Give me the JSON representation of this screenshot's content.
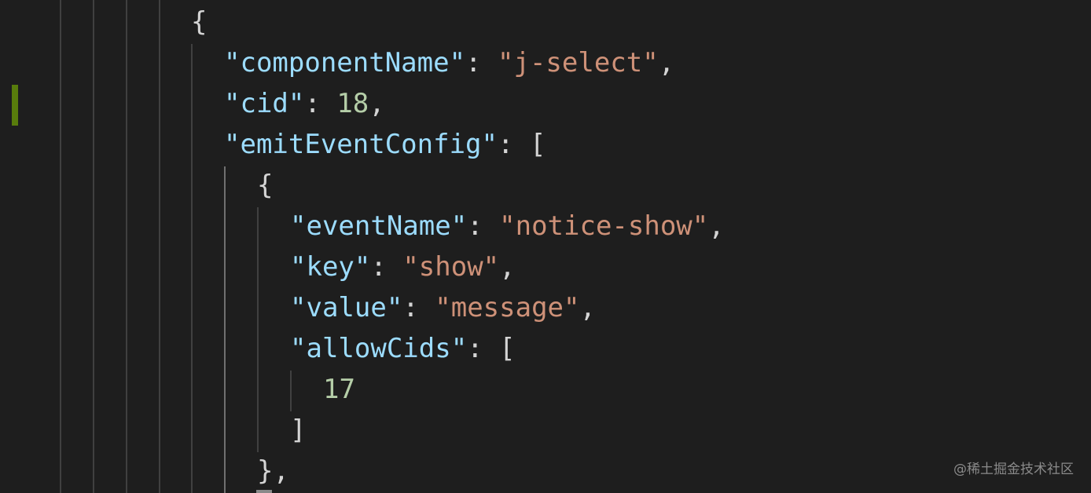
{
  "editor": {
    "lines": [
      {
        "tokens": [
          {
            "t": "{",
            "c": "punc"
          }
        ]
      },
      {
        "tokens": [
          {
            "t": "\"componentName\"",
            "c": "key"
          },
          {
            "t": ": ",
            "c": "punc"
          },
          {
            "t": "\"j-select\"",
            "c": "str"
          },
          {
            "t": ",",
            "c": "punc"
          }
        ]
      },
      {
        "tokens": [
          {
            "t": "\"cid\"",
            "c": "key"
          },
          {
            "t": ": ",
            "c": "punc"
          },
          {
            "t": "18",
            "c": "num"
          },
          {
            "t": ",",
            "c": "punc"
          }
        ]
      },
      {
        "tokens": [
          {
            "t": "\"emitEventConfig\"",
            "c": "key"
          },
          {
            "t": ": [",
            "c": "punc"
          }
        ]
      },
      {
        "tokens": [
          {
            "t": "{",
            "c": "punc"
          }
        ]
      },
      {
        "tokens": [
          {
            "t": "\"eventName\"",
            "c": "key"
          },
          {
            "t": ": ",
            "c": "punc"
          },
          {
            "t": "\"notice-show\"",
            "c": "str"
          },
          {
            "t": ",",
            "c": "punc"
          }
        ]
      },
      {
        "tokens": [
          {
            "t": "\"key\"",
            "c": "key"
          },
          {
            "t": ": ",
            "c": "punc"
          },
          {
            "t": "\"show\"",
            "c": "str"
          },
          {
            "t": ",",
            "c": "punc"
          }
        ]
      },
      {
        "tokens": [
          {
            "t": "\"value\"",
            "c": "key"
          },
          {
            "t": ": ",
            "c": "punc"
          },
          {
            "t": "\"message\"",
            "c": "str"
          },
          {
            "t": ",",
            "c": "punc"
          }
        ]
      },
      {
        "tokens": [
          {
            "t": "\"allowCids\"",
            "c": "key"
          },
          {
            "t": ": [",
            "c": "punc"
          }
        ]
      },
      {
        "tokens": [
          {
            "t": "17",
            "c": "num"
          }
        ]
      },
      {
        "tokens": [
          {
            "t": "]",
            "c": "punc"
          }
        ]
      },
      {
        "tokens": [
          {
            "t": "},",
            "c": "punc"
          }
        ]
      }
    ]
  },
  "watermark": "@稀土掘金技术社区",
  "colors": {
    "background": "#1e1e1e",
    "key": "#9cdcfe",
    "string": "#ce9178",
    "number": "#b5cea8",
    "punctuation": "#d4d4d4",
    "git_modified": "#587c0c"
  }
}
